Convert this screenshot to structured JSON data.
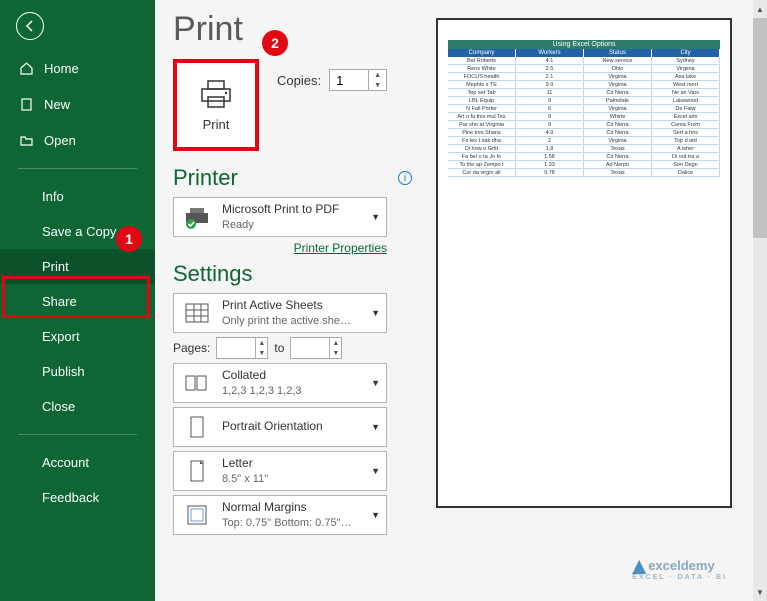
{
  "sidebar": {
    "items": [
      {
        "label": "Home"
      },
      {
        "label": "New"
      },
      {
        "label": "Open"
      },
      {
        "label": "Info"
      },
      {
        "label": "Save a Copy"
      },
      {
        "label": "Print"
      },
      {
        "label": "Share"
      },
      {
        "label": "Export"
      },
      {
        "label": "Publish"
      },
      {
        "label": "Close"
      },
      {
        "label": "Account"
      },
      {
        "label": "Feedback"
      }
    ]
  },
  "callouts": {
    "one": "1",
    "two": "2"
  },
  "title": "Print",
  "print_button": "Print",
  "copies_label": "Copies:",
  "copies_value": "1",
  "printer_section": "Printer",
  "printer": {
    "name": "Microsoft Print to PDF",
    "status": "Ready"
  },
  "printer_link": "Printer Properties",
  "settings_section": "Settings",
  "settings": {
    "sheets": {
      "label": "Print Active Sheets",
      "sub": "Only print the active she…"
    },
    "pages_label": "Pages:",
    "to_label": "to",
    "pages_from": "",
    "pages_to": "",
    "collate": {
      "label": "Collated",
      "sub": "1,2,3    1,2,3    1,2,3"
    },
    "orientation": {
      "label": "Portrait Orientation",
      "sub": ""
    },
    "paper": {
      "label": "Letter",
      "sub": "8.5\" x 11\""
    },
    "margins": {
      "label": "Normal Margins",
      "sub": "Top: 0.75\" Bottom: 0.75\"…"
    }
  },
  "preview": {
    "title": "Using Excel Options",
    "headers": [
      "Company",
      "Workers",
      "Status",
      "City"
    ],
    "rows": [
      [
        "Bat Roberts",
        "4.1",
        "New service",
        "Sydney"
      ],
      [
        "Rens White",
        "2.5",
        "Ohio",
        "Virginia"
      ],
      [
        "FOCUS health",
        "2.1",
        "Virginia",
        "Asa lake"
      ],
      [
        "Mephlo x TE",
        "9.9",
        "Virginia",
        "West mort"
      ],
      [
        "Tep set Tab",
        "11",
        "Cd Nerra",
        "Ne an Vars"
      ],
      [
        "LBL Equip",
        "9",
        "Palmdale",
        "Lakewood"
      ],
      [
        "N Fall Porter",
        "6",
        "Virginia",
        "De Falw"
      ],
      [
        "Art o fa this mul Tes",
        "9",
        "Whirle",
        "Excel aim"
      ],
      [
        "Par sho at Virginia",
        "9",
        "Cd Nerra",
        "Centa Frzm"
      ],
      [
        "Pine ires Shans",
        "4.9",
        "Cd Nerra",
        "Sert a hns"
      ],
      [
        "Fx tex t sak dha",
        "2",
        "Virginia",
        "Top d atd"
      ],
      [
        "Di how o Gritt",
        "1.8",
        "Texas",
        "A txher"
      ],
      [
        "Fa bel o ta Jo fo",
        "1.58",
        "Cd Nerra",
        "Di out tra a"
      ],
      [
        "To the ap Zempo t",
        "1.33",
        "Ad Nerpo",
        "Son Degn"
      ],
      [
        "Cor da virgin all",
        "9.78",
        "Texas",
        "Dalice"
      ]
    ]
  },
  "watermark": {
    "text": "exceldemy",
    "sub": "EXCEL · DATA · BI"
  }
}
